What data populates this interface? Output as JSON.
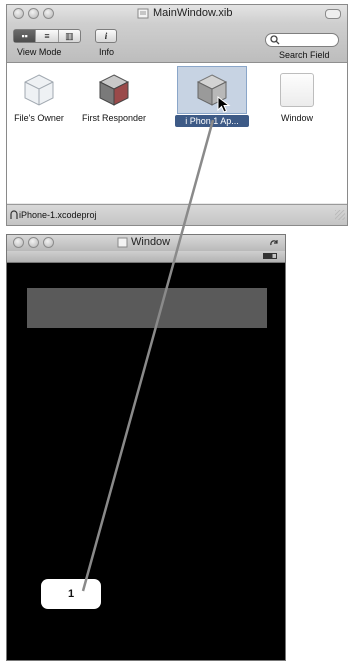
{
  "xib_window": {
    "title": "MainWindow.xib",
    "toolbar": {
      "view_mode_label": "View Mode",
      "info_label": "Info",
      "info_glyph": "i",
      "search_label": "Search Field",
      "search_placeholder": ""
    },
    "objects": [
      {
        "label": "File's Owner",
        "icon": "translucent-cube-icon"
      },
      {
        "label": "First Responder",
        "icon": "red-cube-icon"
      },
      {
        "label": "i Phon  1 Ap...",
        "icon": "app-delegate-cube-icon",
        "selected": true
      },
      {
        "label": "Window",
        "icon": "window-icon"
      }
    ],
    "status_text": "iPhone-1.xcodeproj"
  },
  "iphone_window": {
    "title": "Window"
  },
  "callout": {
    "label": "1"
  },
  "colors": {
    "selection": "#8aa6c9",
    "selection_label_bg": "#3d5a86",
    "connection_line": "#8a8a8a",
    "screen_bg": "#000000",
    "placeholder_bar": "#5a5a5a"
  }
}
